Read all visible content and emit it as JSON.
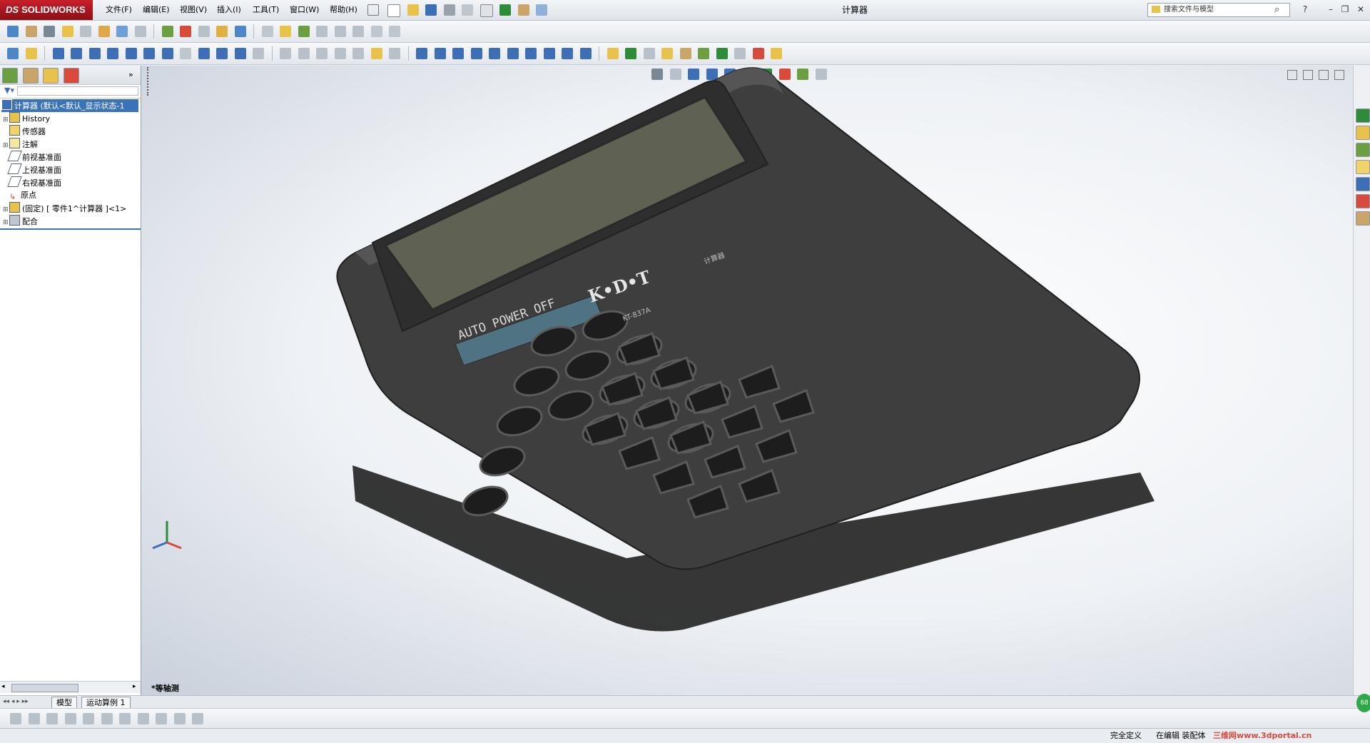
{
  "app": {
    "logo_text": "SOLIDWORKS",
    "document_title": "计算器"
  },
  "menu": [
    "文件(F)",
    "编辑(E)",
    "视图(V)",
    "插入(I)",
    "工具(T)",
    "窗口(W)",
    "帮助(H)"
  ],
  "search": {
    "placeholder": "搜索文件与模型"
  },
  "window_buttons": [
    "?",
    "–",
    "❐",
    "✕"
  ],
  "tree": {
    "root": "计算器 (默认<默认_显示状态-1",
    "items": [
      {
        "label": "History",
        "icon": "history-icon"
      },
      {
        "label": "传感器",
        "icon": "sensor-icon"
      },
      {
        "label": "注解",
        "icon": "annotation-icon"
      },
      {
        "label": "前视基准面",
        "icon": "plane-icon"
      },
      {
        "label": "上视基准面",
        "icon": "plane-icon"
      },
      {
        "label": "右视基准面",
        "icon": "plane-icon"
      },
      {
        "label": "原点",
        "icon": "origin-icon"
      },
      {
        "label": "(固定) [ 零件1^计算器 ]<1>",
        "icon": "part-icon"
      },
      {
        "label": "配合",
        "icon": "mate-icon"
      }
    ]
  },
  "view": {
    "orientation_label": "*等轴测"
  },
  "model": {
    "brand": "K•D•T",
    "model_no": "KT-837A",
    "auto_off": "AUTO POWER OFF",
    "small_text": "计算器",
    "colors": {
      "body": "#3c3c3c",
      "lcd": "#5f6152",
      "solar": "#4f7383"
    }
  },
  "bottom_tabs": [
    "模型",
    "运动算例 1"
  ],
  "status": {
    "left": "完全定义",
    "mid": "在编辑 装配体",
    "watermark": "三维网www.3dportal.cn"
  },
  "badge": "68"
}
